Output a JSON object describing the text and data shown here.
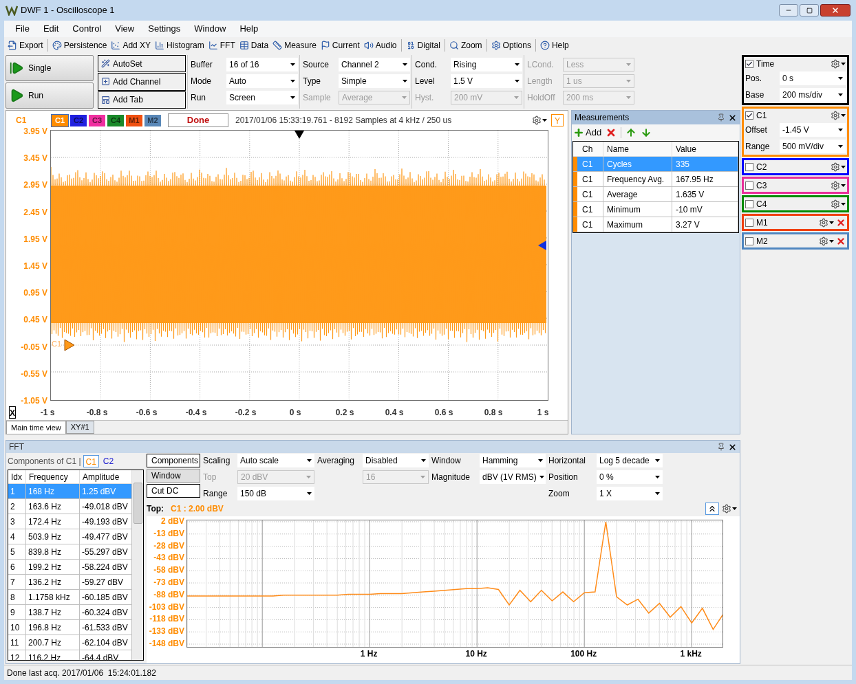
{
  "window": {
    "title": "DWF 1 - Oscilloscope 1"
  },
  "menu": [
    "File",
    "Edit",
    "Control",
    "View",
    "Settings",
    "Window",
    "Help"
  ],
  "toolbar": [
    [
      "Export"
    ],
    [
      "Persistence",
      "Add XY",
      "Histogram",
      "FFT",
      "Data",
      "Measure",
      "Current",
      "Audio"
    ],
    [
      "Digital"
    ],
    [
      "Zoom"
    ],
    [
      "Options"
    ],
    [
      "Help"
    ]
  ],
  "run_buttons": [
    "Single",
    "Run"
  ],
  "action_buttons": [
    "AutoSet",
    "Add Channel",
    "Add Tab"
  ],
  "settings": [
    [
      {
        "label": "Buffer",
        "value": "16 of 16",
        "disabled": false
      },
      {
        "label": "Mode",
        "value": "Auto",
        "disabled": false
      },
      {
        "label": "Run",
        "value": "Screen",
        "disabled": false
      }
    ],
    [
      {
        "label": "Source",
        "value": "Channel 2",
        "disabled": false
      },
      {
        "label": "Type",
        "value": "Simple",
        "disabled": false
      },
      {
        "label": "Sample",
        "value": "Average",
        "disabled": true
      }
    ],
    [
      {
        "label": "Cond.",
        "value": "Rising",
        "disabled": false
      },
      {
        "label": "Level",
        "value": "1.5 V",
        "disabled": false
      },
      {
        "label": "Hyst.",
        "value": "200 mV",
        "disabled": true
      }
    ],
    [
      {
        "label": "LCond.",
        "value": "Less",
        "disabled": true
      },
      {
        "label": "Length",
        "value": "1 us",
        "disabled": true
      },
      {
        "label": "HoldOff",
        "value": "200 ms",
        "disabled": true
      }
    ]
  ],
  "channels": [
    {
      "name": "Time",
      "color": "#000000",
      "checked": true,
      "removable": false,
      "fields": [
        {
          "label": "Pos.",
          "value": "0 s"
        },
        {
          "label": "Base",
          "value": "200 ms/div"
        }
      ]
    },
    {
      "name": "C1",
      "color": "#ff8c00",
      "checked": true,
      "removable": false,
      "fields": [
        {
          "label": "Offset",
          "value": "-1.45 V"
        },
        {
          "label": "Range",
          "value": "500 mV/div"
        }
      ]
    },
    {
      "name": "C2",
      "color": "#0000ff",
      "checked": false,
      "removable": false
    },
    {
      "name": "C3",
      "color": "#e8309a",
      "checked": false,
      "removable": false
    },
    {
      "name": "C4",
      "color": "#008a00",
      "checked": false,
      "removable": false
    },
    {
      "name": "M1",
      "color": "#f04010",
      "checked": false,
      "removable": true
    },
    {
      "name": "M2",
      "color": "#4f86c0",
      "checked": false,
      "removable": true
    }
  ],
  "scope": {
    "channel_label": "C1",
    "channel_buttons": [
      {
        "label": "C1",
        "color": "#ff8c00",
        "selected": true
      },
      {
        "label": "C2",
        "color": "#2020e0",
        "selected": false
      },
      {
        "label": "C3",
        "color": "#f030a0",
        "selected": false
      },
      {
        "label": "C4",
        "color": "#1a8a2a",
        "selected": false
      },
      {
        "label": "M1",
        "color": "#f05010",
        "selected": false
      },
      {
        "label": "M2",
        "color": "#5a88b8",
        "selected": false
      }
    ],
    "status": "Done",
    "info": "2017/01/06 15:33:19.761 - 8192 Samples at 4 kHz / 250 us",
    "y_button": "Y",
    "x_button": "X",
    "y_labels": [
      "3.95 V",
      "3.45 V",
      "2.95 V",
      "2.45 V",
      "1.95 V",
      "1.45 V",
      "0.95 V",
      "0.45 V",
      "-0.05 V",
      "-0.55 V",
      "-1.05 V"
    ],
    "x_labels": [
      "-1 s",
      "-0.8 s",
      "-0.6 s",
      "-0.4 s",
      "-0.2 s",
      "0 s",
      "0.2 s",
      "0.4 s",
      "0.6 s",
      "0.8 s",
      "1 s"
    ],
    "marker_label": "C1",
    "tabs": [
      {
        "label": "Main time view",
        "selected": true
      },
      {
        "label": "XY#1",
        "selected": false
      }
    ]
  },
  "measurements": {
    "title": "Measurements",
    "add": "Add",
    "columns": [
      "Ch",
      "Name",
      "Value"
    ],
    "rows": [
      {
        "cells": [
          "C1",
          "Cycles",
          "335"
        ],
        "color": "#ff8c00",
        "selected": true
      },
      {
        "cells": [
          "C1",
          "Frequency Avg.",
          "167.95 Hz"
        ],
        "color": "#ff8c00",
        "selected": false
      },
      {
        "cells": [
          "C1",
          "Average",
          "1.635 V"
        ],
        "color": "#ff8c00",
        "selected": false
      },
      {
        "cells": [
          "C1",
          "Minimum",
          "-10 mV"
        ],
        "color": "#ff8c00",
        "selected": false
      },
      {
        "cells": [
          "C1",
          "Maximum",
          "3.27 V"
        ],
        "color": "#ff8c00",
        "selected": false
      }
    ]
  },
  "fft": {
    "title": "FFT",
    "components_label": "Components of C1 |",
    "source_tabs": [
      {
        "label": "C1",
        "selected": true
      },
      {
        "label": "C2",
        "selected": false
      }
    ],
    "columns": [
      "Idx",
      "Frequency",
      "Amplitude"
    ],
    "rows": [
      {
        "cells": [
          "1",
          "168 Hz",
          "1.25 dBV"
        ],
        "selected": true
      },
      {
        "cells": [
          "2",
          "163.6 Hz",
          "-49.018 dBV"
        ],
        "selected": false
      },
      {
        "cells": [
          "3",
          "172.4 Hz",
          "-49.193 dBV"
        ],
        "selected": false
      },
      {
        "cells": [
          "4",
          "503.9 Hz",
          "-49.477 dBV"
        ],
        "selected": false
      },
      {
        "cells": [
          "5",
          "839.8 Hz",
          "-55.297 dBV"
        ],
        "selected": false
      },
      {
        "cells": [
          "6",
          "199.2 Hz",
          "-58.224 dBV"
        ],
        "selected": false
      },
      {
        "cells": [
          "7",
          "136.2 Hz",
          "-59.27 dBV"
        ],
        "selected": false
      },
      {
        "cells": [
          "8",
          "1.1758 kHz",
          "-60.185 dBV"
        ],
        "selected": false
      },
      {
        "cells": [
          "9",
          "138.7 Hz",
          "-60.324 dBV"
        ],
        "selected": false
      },
      {
        "cells": [
          "10",
          "196.8 Hz",
          "-61.533 dBV"
        ],
        "selected": false
      },
      {
        "cells": [
          "11",
          "200.7 Hz",
          "-62.104 dBV"
        ],
        "selected": false
      },
      {
        "cells": [
          "12",
          "116.2 Hz",
          "-64.4 dBV"
        ],
        "selected": false
      }
    ],
    "mode_buttons": [
      {
        "label": "Components",
        "selected": false
      },
      {
        "label": "Window",
        "selected": true
      },
      {
        "label": "Cut DC",
        "selected": false
      }
    ],
    "settings": [
      [
        {
          "label": "Scaling",
          "value": "Auto scale",
          "disabled": false
        },
        {
          "label": "Top",
          "value": "20 dBV",
          "disabled": true
        },
        {
          "label": "Range",
          "value": "150 dB",
          "disabled": false
        }
      ],
      [
        {
          "label": "Averaging",
          "value": "Disabled",
          "disabled": false
        },
        {
          "value": "16",
          "disabled": true
        }
      ],
      [
        {
          "label": "Window",
          "value": "Hamming",
          "disabled": false
        },
        {
          "label": "Magnitude",
          "value": "dBV (1V RMS)",
          "disabled": false
        }
      ],
      [
        {
          "label": "Horizontal",
          "value": "Log 5 decade",
          "disabled": false
        },
        {
          "label": "Position",
          "value": "0 %",
          "disabled": false
        },
        {
          "label": "Zoom",
          "value": "1 X",
          "disabled": false
        }
      ]
    ],
    "top_label": "Top:",
    "top_value": "C1 : 2.00 dBV",
    "chart_data": {
      "type": "line",
      "categories": [
        null,
        null,
        null,
        null,
        null,
        null,
        null,
        null,
        null,
        null,
        null,
        null,
        null,
        null,
        null,
        null,
        null,
        "1 Hz",
        null,
        null,
        null,
        null,
        null,
        null,
        null,
        null,
        null,
        "10 Hz",
        null,
        null,
        null,
        null,
        null,
        null,
        null,
        null,
        null,
        "100 Hz",
        null,
        null,
        null,
        null,
        null,
        null,
        null,
        null,
        null,
        "1 kHz",
        null,
        null,
        null
      ],
      "series": [
        {
          "color": "#ff8c1a",
          "values": [
            -89,
            -89,
            -89,
            -89,
            -89,
            -89,
            -89,
            -89,
            -89,
            -88,
            -88,
            -88,
            -88,
            -88,
            -88,
            -87,
            -87,
            -87,
            -86,
            -86,
            -86,
            -85,
            -84,
            -83,
            -82,
            -81,
            -80,
            -80,
            -79,
            -81,
            -100,
            -82,
            -96,
            -82,
            -95,
            -84,
            -96,
            -85,
            -84,
            2,
            -90,
            -100,
            -93,
            -110,
            -98,
            -115,
            -102,
            -122,
            -104,
            -130,
            -110
          ]
        }
      ],
      "ylim": [
        -148,
        2
      ],
      "grid": true,
      "yticks": [
        {
          "value": 2,
          "label": "2 dBV"
        },
        {
          "value": -13,
          "label": "-13 dBV"
        },
        {
          "value": -28,
          "label": "-28 dBV"
        },
        {
          "value": -43,
          "label": "-43 dBV"
        },
        {
          "value": -58,
          "label": "-58 dBV"
        },
        {
          "value": -73,
          "label": "-73 dBV"
        },
        {
          "value": -88,
          "label": "-88 dBV"
        },
        {
          "value": -103,
          "label": "-103 dBV"
        },
        {
          "value": -118,
          "label": "-118 dBV"
        },
        {
          "value": -133,
          "label": "-133 dBV"
        },
        {
          "value": -148,
          "label": "-148 dBV"
        }
      ]
    }
  },
  "status_bar": "Done last acq. 2017/01/06  15:24:01.182"
}
